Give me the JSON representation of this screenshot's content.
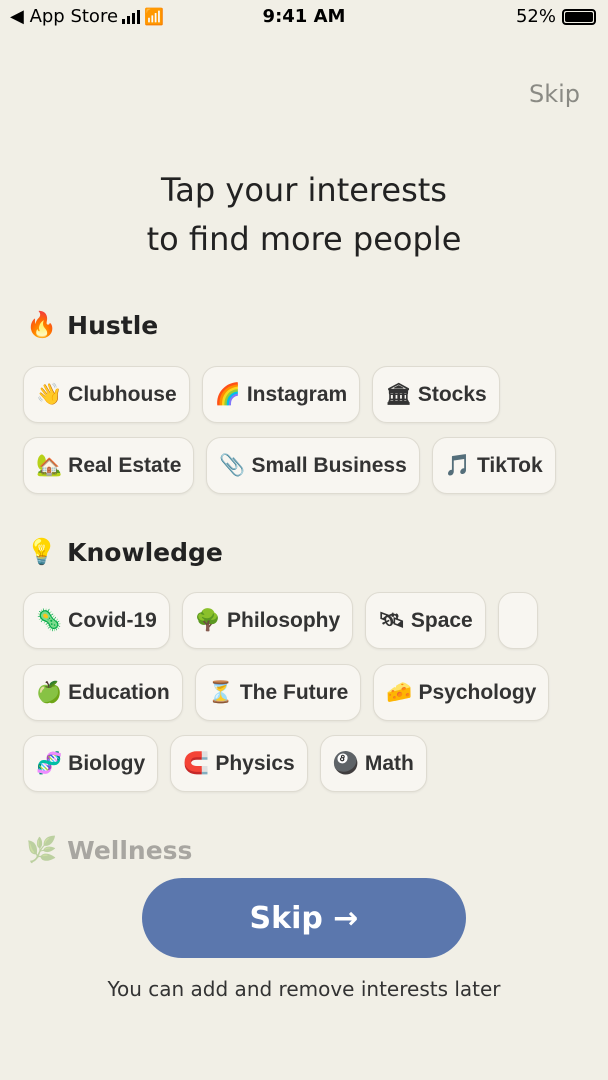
{
  "status_bar": {
    "back_app": "◀ App Store",
    "time": "9:41 AM",
    "battery": "52%",
    "battery_level": 0.52
  },
  "header": {
    "skip_label": "Skip"
  },
  "title_line1": "Tap your interests",
  "title_line2": "to find more people",
  "sections": [
    {
      "emoji": "🔥",
      "name": "Hustle",
      "rows": [
        [
          {
            "emoji": "👋",
            "label": "Clubhouse"
          },
          {
            "emoji": "🌈",
            "label": "Instagram"
          },
          {
            "emoji": "🏛",
            "label": "Stocks"
          }
        ],
        [
          {
            "emoji": "🏡",
            "label": "Real Estate"
          },
          {
            "emoji": "📎",
            "label": "Small Business"
          },
          {
            "emoji": "🎵",
            "label": "TikTok"
          }
        ]
      ]
    },
    {
      "emoji": "💡",
      "name": "Knowledge",
      "rows": [
        [
          {
            "emoji": "🦠",
            "label": "Covid-19"
          },
          {
            "emoji": "🌳",
            "label": "Philosophy"
          },
          {
            "emoji": "🛰",
            "label": "Space"
          },
          {
            "emoji": "",
            "label": ""
          }
        ],
        [
          {
            "emoji": "🍏",
            "label": "Education"
          },
          {
            "emoji": "⏳",
            "label": "The Future"
          },
          {
            "emoji": "🧀",
            "label": "Psychology"
          }
        ],
        [
          {
            "emoji": "🧬",
            "label": "Biology"
          },
          {
            "emoji": "🧲",
            "label": "Physics"
          },
          {
            "emoji": "🎱",
            "label": "Math"
          }
        ]
      ]
    },
    {
      "emoji": "🌿",
      "name": "Wellness"
    }
  ],
  "cta": {
    "label": "Skip →"
  },
  "footer_note": "You can add and remove interests later",
  "colors": {
    "background": "#f1efe6",
    "button": "#5b77ad"
  }
}
